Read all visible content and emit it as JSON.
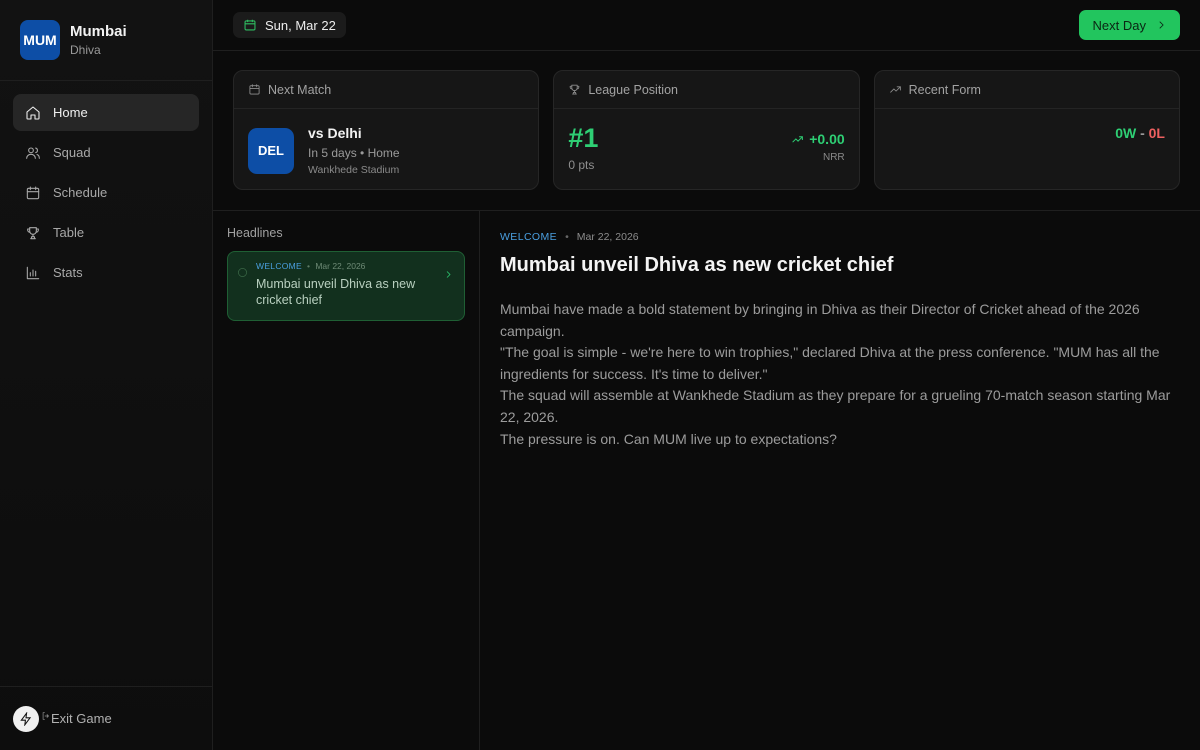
{
  "sidebar": {
    "team_logo": "MUM",
    "team_name": "Mumbai",
    "manager_name": "Dhiva",
    "nav": [
      {
        "label": "Home",
        "icon": "home-icon",
        "active": true
      },
      {
        "label": "Squad",
        "icon": "users-icon"
      },
      {
        "label": "Schedule",
        "icon": "calendar-icon"
      },
      {
        "label": "Table",
        "icon": "trophy-icon"
      },
      {
        "label": "Stats",
        "icon": "bar-chart-icon"
      }
    ],
    "exit_label": "Exit Game"
  },
  "topbar": {
    "date": "Sun, Mar 22",
    "next_day_label": "Next Day"
  },
  "cards": {
    "next_match": {
      "title": "Next Match",
      "opponent_logo": "DEL",
      "opponent": "vs Delhi",
      "info": "In 5 days • Home",
      "venue": "Wankhede Stadium"
    },
    "league_position": {
      "title": "League Position",
      "rank": "#1",
      "points": "0 pts",
      "nrr_value": "+0.00",
      "nrr_label": "NRR"
    },
    "recent_form": {
      "title": "Recent Form",
      "wins": "0W",
      "separator": " - ",
      "losses": "0L"
    }
  },
  "headlines": {
    "title": "Headlines",
    "items": [
      {
        "tag": "WELCOME",
        "date": "Mar 22, 2026",
        "title": "Mumbai unveil Dhiva as new cricket chief"
      }
    ]
  },
  "article": {
    "tag": "WELCOME",
    "date": "Mar 22, 2026",
    "title": "Mumbai unveil Dhiva as new cricket chief",
    "paragraphs": [
      "Mumbai have made a bold statement by bringing in Dhiva as their Director of Cricket ahead of the 2026 campaign.",
      "\"The goal is simple - we're here to win trophies,\" declared Dhiva at the press conference. \"MUM has all the ingredients for success. It's time to deliver.\"",
      "The squad will assemble at Wankhede Stadium as they prepare for a grueling 70-match season starting Mar 22, 2026.",
      "The pressure is on. Can MUM live up to expectations?"
    ]
  },
  "colors": {
    "accent_green": "#22c55e",
    "positive": "#2ecf74",
    "negative": "#ef6060",
    "team_blue": "#0d4ea6",
    "tag_blue": "#4a9fe0"
  }
}
